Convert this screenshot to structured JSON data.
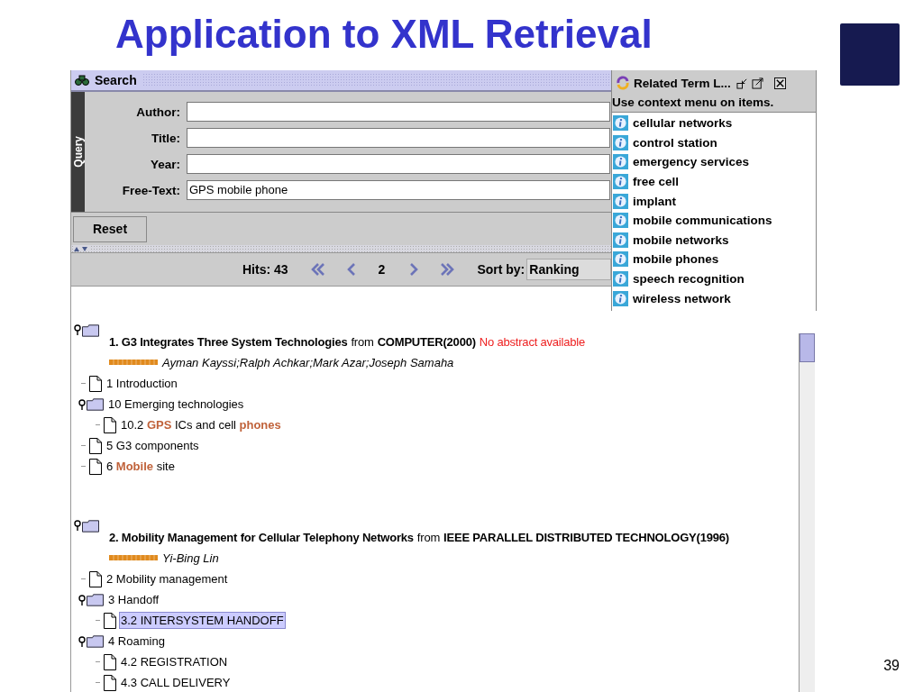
{
  "slide": {
    "title": "Application to XML Retrieval",
    "page_number": "39"
  },
  "search_window": {
    "title": "Search",
    "query_tab": "Query",
    "fields": [
      {
        "label": "Author:"
      },
      {
        "label": "Title:"
      },
      {
        "label": "Year:"
      },
      {
        "label": "Free-Text:",
        "value": "GPS mobile phone"
      }
    ],
    "reset_button": "Reset",
    "results_bar": {
      "hits": "Hits: 43",
      "page": "2",
      "sort_label": "Sort by:",
      "sort_value": "Ranking"
    },
    "results": [
      {
        "title": "1. G3 Integrates Three System Technologies",
        "from": "from",
        "source": "COMPUTER(2000)",
        "note": "No abstract available",
        "authors": "Ayman Kayssi;Ralph Achkar;Mark Azar;Joseph Samaha",
        "sections": [
          {
            "kind": "document",
            "label": "1 Introduction",
            "selected": false
          },
          {
            "kind": "folder",
            "label": "10 Emerging technologies",
            "selected": false,
            "children": [
              {
                "kind": "document",
                "label": "10.2 **GPS** ICs and cell **phones**",
                "selected": false
              }
            ]
          },
          {
            "kind": "document",
            "label": "5 G3 components",
            "selected": false
          },
          {
            "kind": "document",
            "label": "6 **Mobile** site",
            "selected": false
          }
        ]
      },
      {
        "title": "2. Mobility Management for Cellular Telephony Networks",
        "from": "from",
        "source": "IEEE PARALLEL DISTRIBUTED TECHNOLOGY(1996)",
        "authors": "Yi-Bing Lin",
        "sections": [
          {
            "kind": "document",
            "label": "2 Mobility management",
            "selected": false
          },
          {
            "kind": "folder",
            "label": "3 Handoff",
            "selected": false,
            "children": [
              {
                "kind": "document",
                "label": "3.2 INTERSYSTEM HANDOFF",
                "selected": true
              }
            ]
          },
          {
            "kind": "folder",
            "label": "4 Roaming",
            "selected": false,
            "children": [
              {
                "kind": "document",
                "label": "4.2 REGISTRATION",
                "selected": false
              },
              {
                "kind": "document",
                "label": "4.3 CALL DELIVERY",
                "selected": false
              }
            ]
          }
        ]
      }
    ]
  },
  "related_terms": {
    "title": "Related Term L...",
    "hint": "Use context menu on items.",
    "items": [
      "cellular networks",
      "control station",
      "emergency services",
      "free cell",
      "implant",
      "mobile communications",
      "mobile networks",
      "mobile phones",
      "speech recognition",
      "wireless network"
    ]
  }
}
